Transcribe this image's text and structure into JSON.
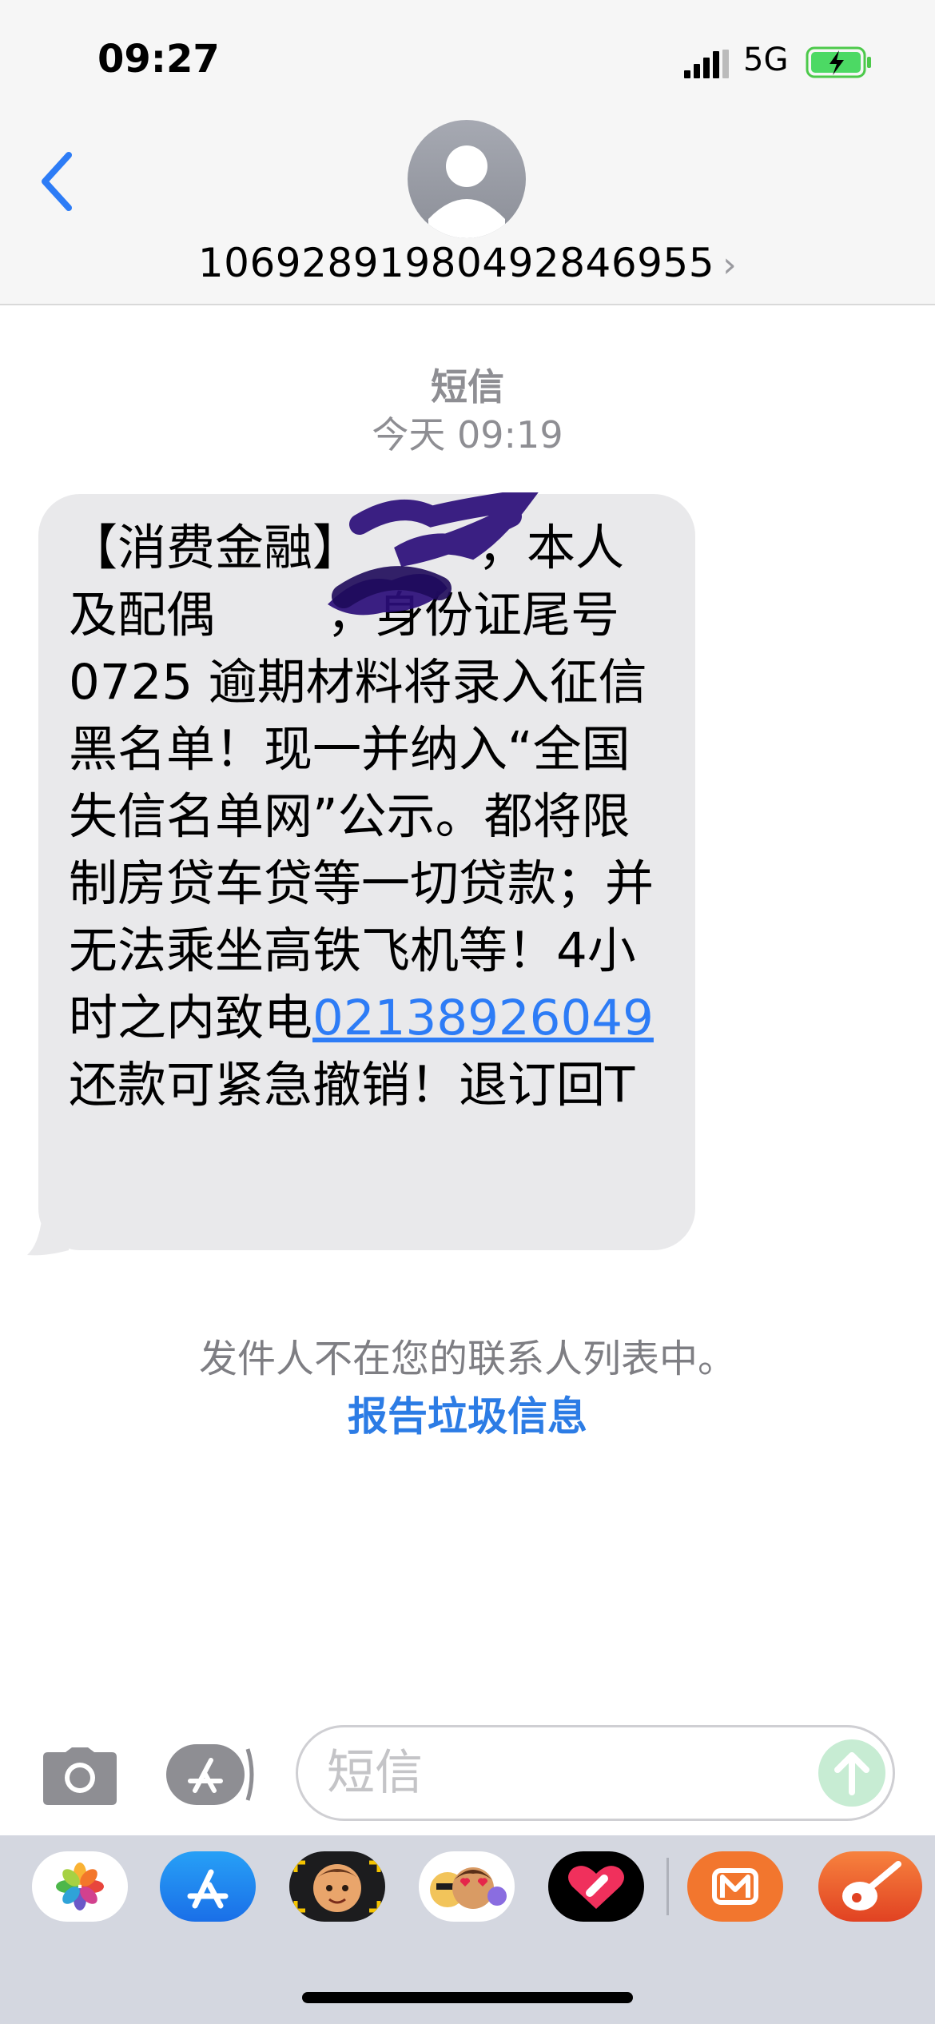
{
  "status_bar": {
    "time": "09:27",
    "network": "5G"
  },
  "header": {
    "contact": "106928919804928469​55"
  },
  "conversation": {
    "service": "短信",
    "timestamp": "今天 09:19",
    "message": {
      "part1": "【消费金融】",
      "part2": "，本人及配偶",
      "part3": "，身份证尾号 0725 逾期材料将录入征信黑名单！现一并纳入“全国失信名单网”公示。都将限制房贷车贷等一切贷款；并无法乘坐高铁飞机等！4小时之内致电",
      "phone": "02138926049",
      "part4": "还款可紧急撤销！退订回T"
    },
    "notice": "发件人不在您的联系人列表中。",
    "report_link": "报告垃圾信息"
  },
  "composer": {
    "placeholder": "短信"
  },
  "dock": {
    "apps": [
      "photos-app",
      "app-store-app",
      "memoji-app",
      "animoji-app",
      "digital-touch-app",
      "mango-tv-app",
      "garageband-app"
    ]
  },
  "colors": {
    "link": "#2d7cf6",
    "accent": "#2c7ce5",
    "bubble": "#e9e9eb"
  }
}
